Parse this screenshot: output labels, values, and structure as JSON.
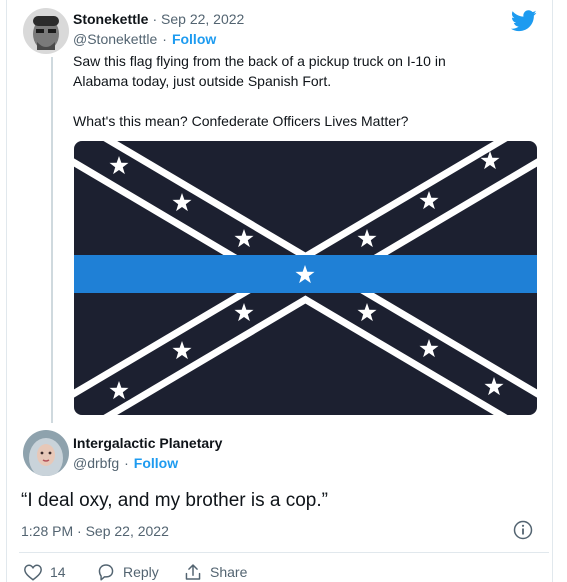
{
  "tweet": {
    "author_name": "Stonekettle",
    "dot_date": "· Sep 22, 2022",
    "handle": "@Stonekettle",
    "follow_label": "Follow",
    "text_line1": "Saw this flag flying from the back of a pickup truck on I-10 in",
    "text_line2": "Alabama today, just outside Spanish Fort.",
    "text_line3": "What's this mean? Confederate Officers Lives Matter?"
  },
  "reply": {
    "author_name": "Intergalactic Planetary",
    "handle": "@drbfg",
    "follow_label": "Follow",
    "text": "“I deal oxy, and my brother is a cop.”",
    "timestamp": "1:28 PM · Sep 22, 2022"
  },
  "actions": {
    "like_count": "14",
    "reply_label": "Reply",
    "share_label": "Share"
  },
  "icons": {
    "brand": "twitter-bird-icon",
    "info": "info-icon",
    "like": "heart-icon",
    "reply": "reply-icon",
    "share": "share-icon"
  },
  "colors": {
    "twitter_blue": "#1d9bf0",
    "flag_background": "#1c2030",
    "thin_blue_line": "#1f80d6"
  }
}
